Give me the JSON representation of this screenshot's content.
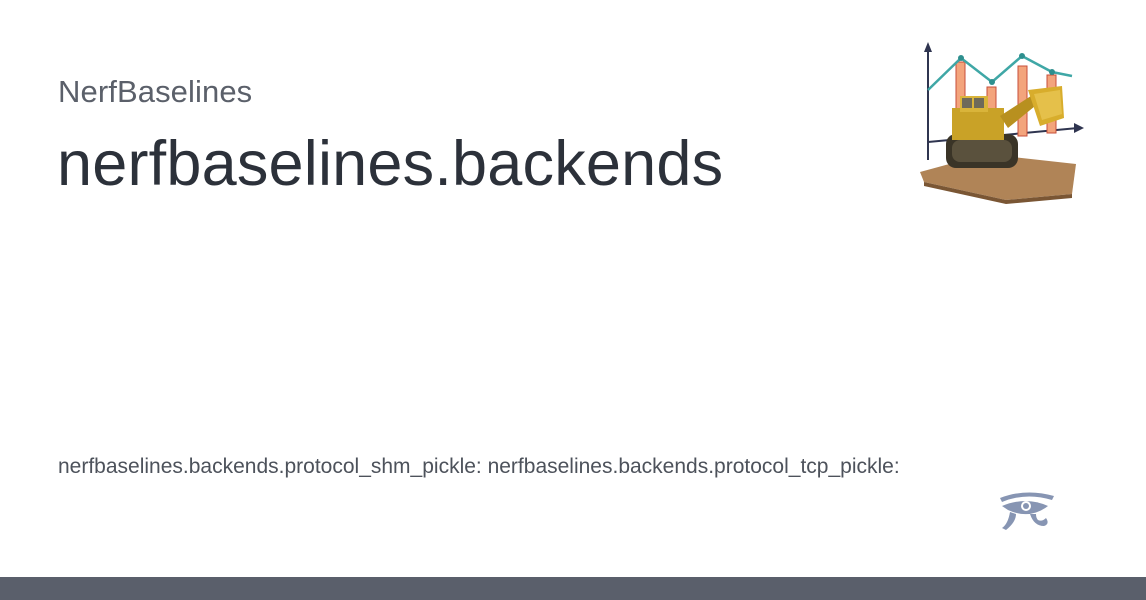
{
  "site": {
    "name": "NerfBaselines"
  },
  "page": {
    "title": "nerfbaselines.backends",
    "description": "nerfbaselines.backends.protocol_shm_pickle: nerfbaselines.backends.protocol_tcp_pickle:"
  },
  "icons": {
    "logo": "nerfbaselines-logo-chart-bulldozer",
    "eye": "eye-of-horus-icon"
  },
  "colors": {
    "footer": "#5a5f6b",
    "title": "#2c313a",
    "site_name": "#5b606a",
    "eye_icon": "#8795b3"
  }
}
